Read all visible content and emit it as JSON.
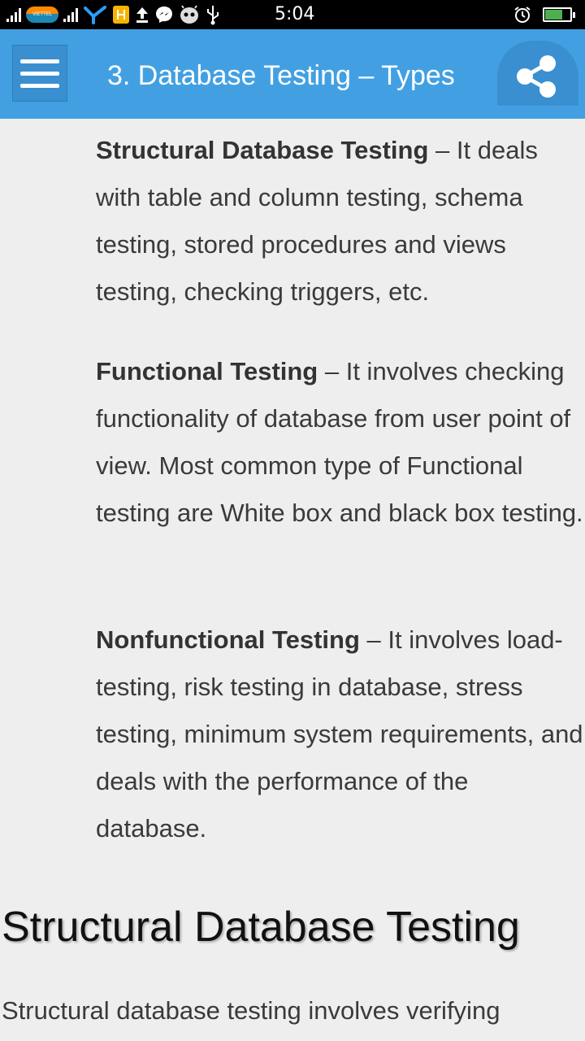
{
  "status_bar": {
    "time": "5:04",
    "carrier": "VIETTEL",
    "icons": [
      "signal-icon",
      "carrier-icon",
      "signal-icon",
      "network-icon",
      "app-icon",
      "upload-icon",
      "messenger-icon",
      "android-icon",
      "usb-icon",
      "alarm-icon",
      "battery-icon"
    ],
    "battery_level": 0.7,
    "battery_color": "#4caf50"
  },
  "app_bar": {
    "title": "3. Database Testing – Types",
    "background": "#42a0e2",
    "menu_icon": "hamburger-menu-icon",
    "share_icon": "share-icon"
  },
  "items": [
    {
      "term": "Structural Database Testing",
      "description": " – It deals with table and column testing, schema testing, stored procedures and views testing, checking triggers, etc."
    },
    {
      "term": "Functional Testing",
      "description": " – It involves checking functionality of database from user point of view. Most common type of Functional testing are White box and black box testing."
    },
    {
      "term": "Nonfunctional Testing",
      "description": " – It involves load-testing, risk testing in database, stress testing, minimum system requirements, and deals with the performance of the database."
    }
  ],
  "section": {
    "heading": "Structural Database Testing",
    "body": "Structural database testing involves verifying"
  }
}
